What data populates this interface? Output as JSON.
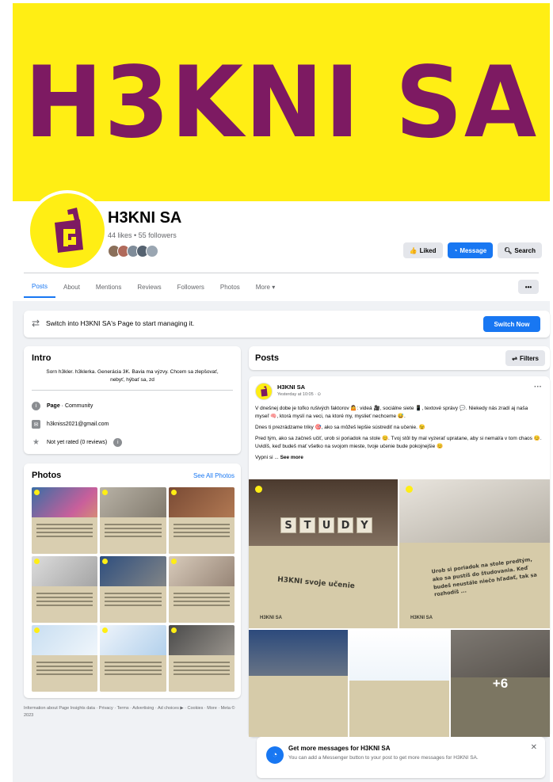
{
  "cover": {
    "text": "H3KNI SA"
  },
  "profile": {
    "name": "H3KNI SA",
    "stats": "44 likes • 55 followers",
    "friend_avatar_colors": [
      "#8a6f5a",
      "#b06a5b",
      "#7f8c99",
      "#556270",
      "#9aa6b2"
    ]
  },
  "actions": {
    "liked": "Liked",
    "message": "Message",
    "search": "Search"
  },
  "tabs": [
    "Posts",
    "About",
    "Mentions",
    "Reviews",
    "Followers",
    "Photos",
    "More ▾"
  ],
  "tabs_more_button": "•••",
  "switch_prompt": {
    "text": "Switch into H3KNI SA's Page to start managing it.",
    "button": "Switch Now"
  },
  "intro": {
    "title": "Intro",
    "bio": "Sorn h3kler. h3klerka. Generácia 3K. Bavia ma výzvy. Chcem sa zlepšovať, nebyť, hýbať sa, zd",
    "category_label": "Page",
    "category_value": " · Community",
    "email": "h3kniss2021@gmail.com",
    "rating": "Not yet rated (0 reviews)"
  },
  "photos": {
    "title": "Photos",
    "see_all": "See All Photos"
  },
  "footer": "Information about Page Insights data · Privacy · Terms · Advertising · Ad choices ▶ · Cookies · More · Meta © 2023",
  "posts": {
    "title": "Posts",
    "filters": "Filters"
  },
  "post": {
    "author": "H3KNI SA",
    "time": "Yesterday at 10:05 · ⊙",
    "paragraphs": [
      "V dnešnej dobe je toľko rušivých faktorov 🤷: videá 🎥, sociálne siete 📱, textové správy 💬. Niekedy nás zradí aj naša myseľ 🧠, ktorá myslí na veci, na ktoré my, myslieť nechceme 😅.",
      "Dnes ti prezrádzame triky 🎯, ako sa môžeš lepšie sústrediť na učenie. 😉",
      "Pred tým, ako sa začneš učiť, urob si poriadok na stole 😊. Tvoj stôl by mal vyzerať upratane, aby si nemal/a v tom chaos 😊. Uvidíš, keď budeš mať všetko na svojom mieste, tvoje učenie bude pokojnejšie 😊"
    ],
    "truncated": "Vypni si ...",
    "see_more": "See more",
    "image1_word": "STUDY",
    "image1_caption": "H3KNI svoje učenie",
    "image2_caption": "Urob si poriadok na stole predtým, ako sa pustíš do študovania. Keď budeš neustále niečo hľadať, tak sa rozhodíš ...",
    "brand": "H3KNI SA",
    "more_count": "+6"
  },
  "promo": {
    "title": "Get more messages for H3KNI SA",
    "text": "You can add a Messenger button to your post to get more messages for H3KNI SA.",
    "close": "✕"
  }
}
